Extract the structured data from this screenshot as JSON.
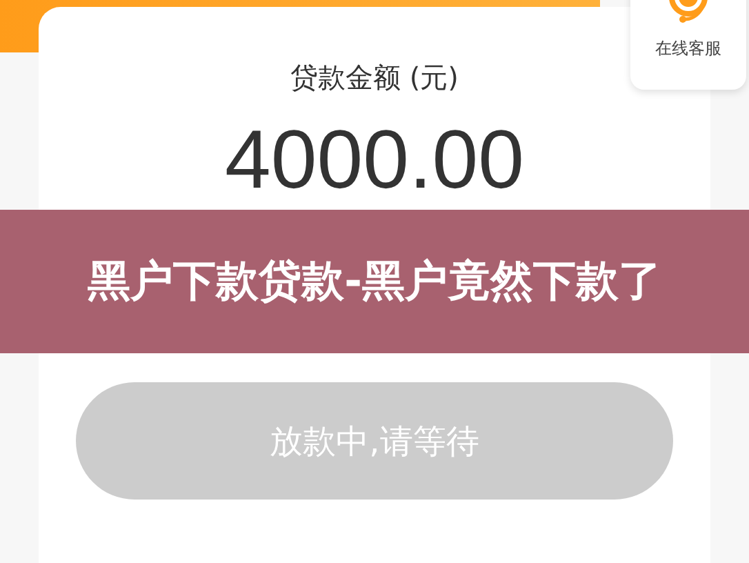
{
  "loan": {
    "label": "贷款金额 (元)",
    "amount": "4000.00"
  },
  "service": {
    "label": "在线客服"
  },
  "banner": {
    "title": "黑户下款贷款-黑户竟然下款了"
  },
  "button": {
    "label": "放款中,请等待",
    "disabled": true
  }
}
